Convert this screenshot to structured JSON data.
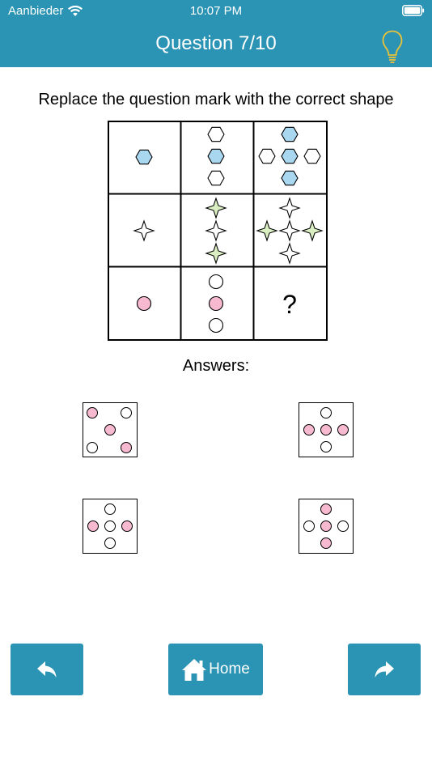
{
  "status_bar": {
    "carrier": "Aanbieder",
    "time": "10:07 PM"
  },
  "header": {
    "title": "Question 7/10",
    "hint_icon": "lightbulb-icon"
  },
  "question": {
    "instruction": "Replace the question mark with the correct shape",
    "missing_symbol": "?"
  },
  "answers": {
    "title": "Answers:"
  },
  "nav": {
    "home_label": "Home",
    "back_icon": "reply-arrow-icon",
    "forward_icon": "forward-arrow-icon",
    "home_icon": "home-icon"
  },
  "colors": {
    "header": "#2b93b3",
    "button": "#2b93b3",
    "hexagon_fill": "#a9d7f0",
    "star_fill": "#d9eec1",
    "circle_fill": "#f6b9cf",
    "bulb": "#e8c23a"
  }
}
